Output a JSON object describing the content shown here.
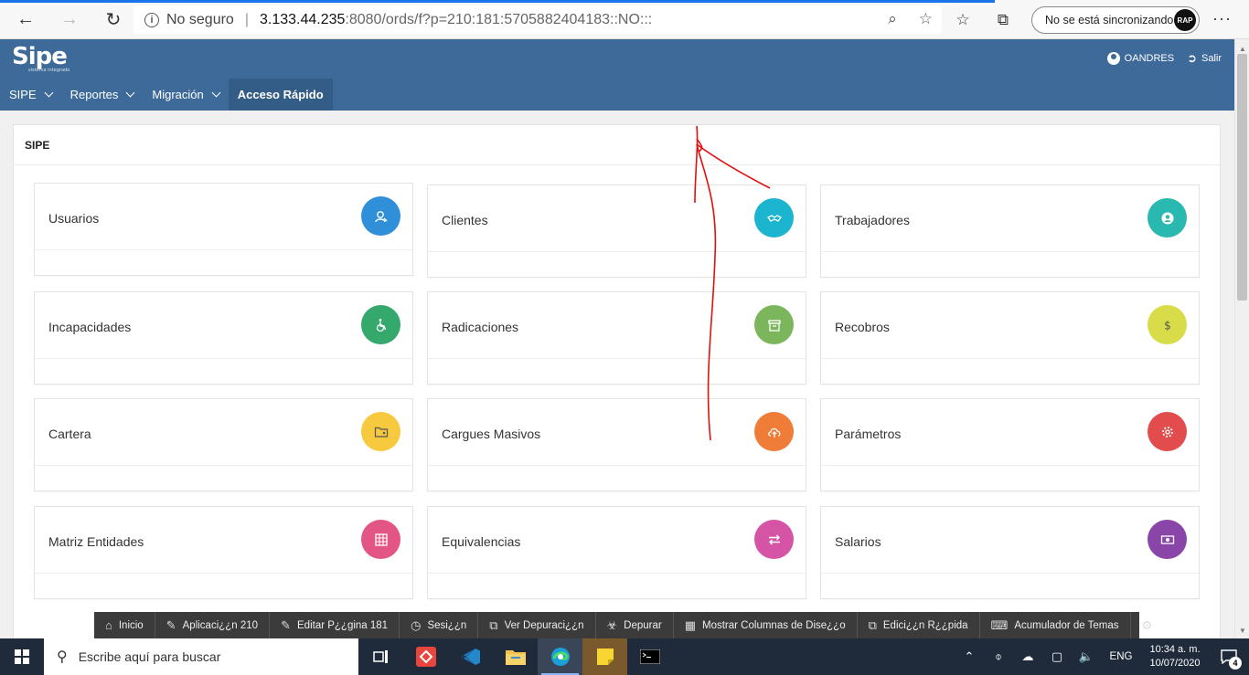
{
  "browser": {
    "security_label": "No seguro",
    "url_host": "3.133.44.235",
    "url_rest": ":8080/ords/f?p=210:181:5705882404183::NO:::",
    "sync_label": "No se está sincronizando",
    "avatar_text": "RAP"
  },
  "app": {
    "logo": "Sipe",
    "logo_sub": "sistema integrado",
    "user": "OANDRES",
    "logout": "Salir",
    "menu": [
      {
        "label": "SIPE"
      },
      {
        "label": "Reportes"
      },
      {
        "label": "Migración"
      },
      {
        "label": "Acceso Rápido"
      }
    ]
  },
  "region": {
    "title": "SIPE",
    "cards": [
      {
        "label": "Usuarios",
        "color": "#2f8fd8",
        "icon": "user-search-icon"
      },
      {
        "label": "Clientes",
        "color": "#1bb5d0",
        "icon": "handshake-icon"
      },
      {
        "label": "Trabajadores",
        "color": "#2ab9b0",
        "icon": "user-circle-icon"
      },
      {
        "label": "Incapacidades",
        "color": "#35a86b",
        "icon": "wheelchair-icon"
      },
      {
        "label": "Radicaciones",
        "color": "#7cb65c",
        "icon": "archive-icon"
      },
      {
        "label": "Recobros",
        "color": "#d8dc48",
        "icon": "dollar-icon"
      },
      {
        "label": "Cartera",
        "color": "#f7c93e",
        "icon": "folder-user-icon"
      },
      {
        "label": "Cargues Masivos",
        "color": "#ef7d37",
        "icon": "cloud-upload-icon"
      },
      {
        "label": "Parámetros",
        "color": "#e24c4c",
        "icon": "gear-icon"
      },
      {
        "label": "Matriz Entidades",
        "color": "#e25585",
        "icon": "grid-icon"
      },
      {
        "label": "Equivalencias",
        "color": "#d654a6",
        "icon": "exchange-icon"
      },
      {
        "label": "Salarios",
        "color": "#8a45a8",
        "icon": "money-icon"
      }
    ]
  },
  "devbar": [
    {
      "label": "Inicio",
      "icon": "home-icon"
    },
    {
      "label": "Aplicaci¿¿n 210",
      "icon": "edit-icon"
    },
    {
      "label": "Editar P¿¿gina 181",
      "icon": "edit-page-icon"
    },
    {
      "label": "Sesi¿¿n",
      "icon": "clock-icon"
    },
    {
      "label": "Ver Depuraci¿¿n",
      "icon": "debug-view-icon"
    },
    {
      "label": "Depurar",
      "icon": "bug-icon"
    },
    {
      "label": "Mostrar Columnas de Dise¿¿o",
      "icon": "grid-columns-icon"
    },
    {
      "label": "Edici¿¿n R¿¿pida",
      "icon": "quick-edit-icon"
    },
    {
      "label": "Acumulador de Temas",
      "icon": "paint-roller-icon"
    }
  ],
  "taskbar": {
    "search_placeholder": "Escribe aquí para buscar",
    "lang": "ENG",
    "time": "10:34 a. m.",
    "date": "10/07/2020",
    "notifications": "4"
  }
}
